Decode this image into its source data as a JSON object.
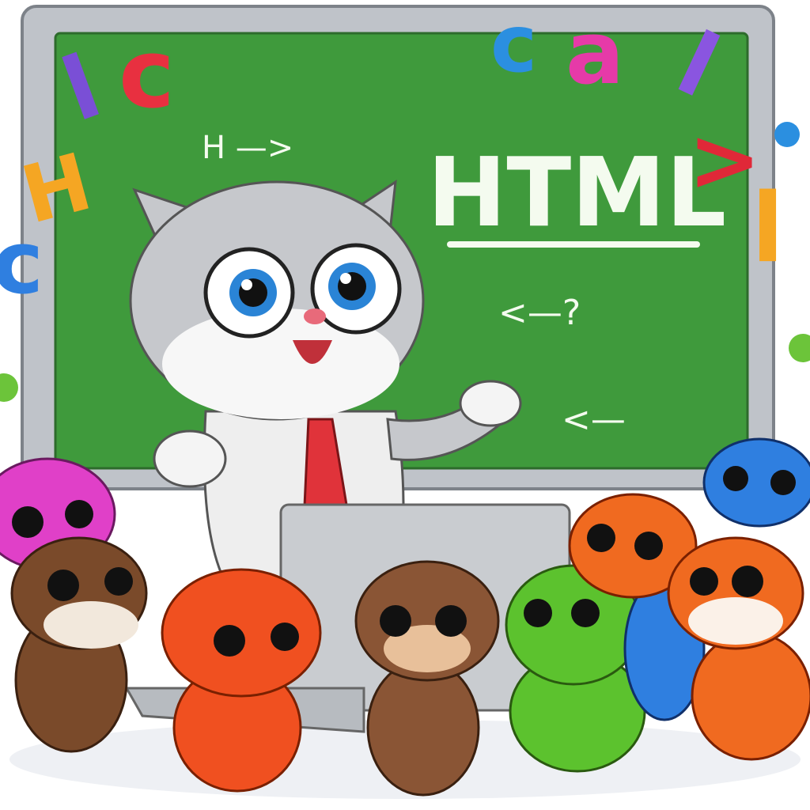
{
  "board": {
    "title": "HTML",
    "line1": "H —>",
    "line2": "<—?",
    "line3": "<—"
  },
  "floating_letters": {
    "l1": "l",
    "c1": "c",
    "h1": "H",
    "c2": "c",
    "c3": "c",
    "a1": "a",
    "l2": "l",
    "gt": ">",
    "l3": "l"
  },
  "colors": {
    "board": "#3f9a3c",
    "frame": "#c9ccd1",
    "teacher": "#c6c8cc",
    "tie": "#e0333a"
  }
}
